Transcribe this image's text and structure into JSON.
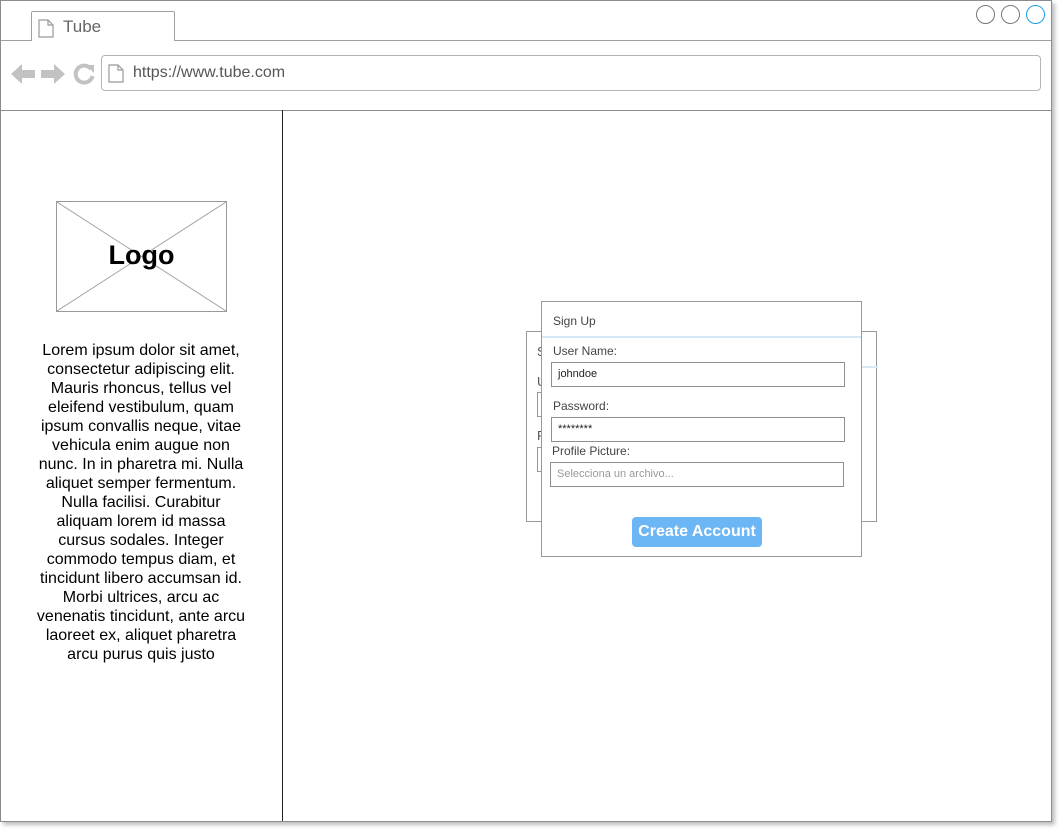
{
  "browser": {
    "tab_title": "Tube",
    "url": "https://www.tube.com",
    "icons": [
      "back-arrow-icon",
      "forward-arrow-icon",
      "reload-icon",
      "page-icon"
    ]
  },
  "sidebar": {
    "logo_text": "Logo",
    "description": "Lorem ipsum dolor sit amet, consectetur adipiscing elit. Mauris rhoncus, tellus vel eleifend vestibulum, quam ipsum convallis neque, vitae vehicula enim augue non nunc. In in pharetra mi. Nulla aliquet semper fermentum. Nulla facilisi. Curabitur aliquam lorem id massa cursus sodales. Integer commodo tempus diam, et tincidunt libero accumsan id. Morbi ultrices, arcu ac venenatis tincidunt, ante arcu laoreet ex, aliquet pharetra arcu purus quis justo"
  },
  "signup": {
    "title": "Sign Up",
    "username_label": "User Name:",
    "username_value": "johndoe",
    "password_label": "Password:",
    "password_value": "********",
    "picture_label": "Profile Picture:",
    "picture_placeholder": "Selecciona un archivo...",
    "create_button": "Create Account"
  },
  "colors": {
    "accent_button": "#6cb6f5",
    "active_window_button": "#1ba1e2",
    "divider_highlight": "#d6e9f8"
  }
}
